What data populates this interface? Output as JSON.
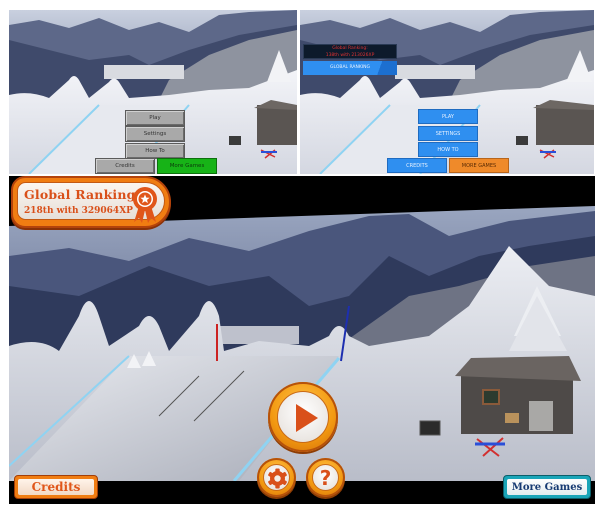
{
  "screens": {
    "classic": {
      "menu": {
        "play": "Play",
        "settings": "Settings",
        "howto": "How To",
        "credits": "Credits",
        "more_games": "More Games"
      },
      "colors": {
        "button": "#a9a9a9",
        "more_games": "#17b317"
      }
    },
    "flat": {
      "ranking_line1": "Global Ranking:",
      "ranking_line2": "138th with 213026XP",
      "global_ranking_button": "GLOBAL RANKING",
      "menu": {
        "play": "PLAY",
        "settings": "SETTINGS",
        "howto": "HOW TO",
        "credits": "CREDITS",
        "more_games": "MORE GAMES"
      },
      "colors": {
        "button": "#2f8ff0",
        "more_games": "#ef8a2a",
        "ranking_text": "#e03232"
      }
    },
    "cartoon": {
      "ranking_title": "Global Ranking:",
      "ranking_detail": "218th with 329064XP",
      "play_icon": "play-triangle",
      "settings_icon": "gear",
      "help_glyph": "?",
      "credits": "Credits",
      "more_games": "More Games",
      "colors": {
        "accent": "#f07d12",
        "text": "#d9501a",
        "more_games_border": "#1aa5b8",
        "more_games_text": "#163a72"
      }
    }
  }
}
